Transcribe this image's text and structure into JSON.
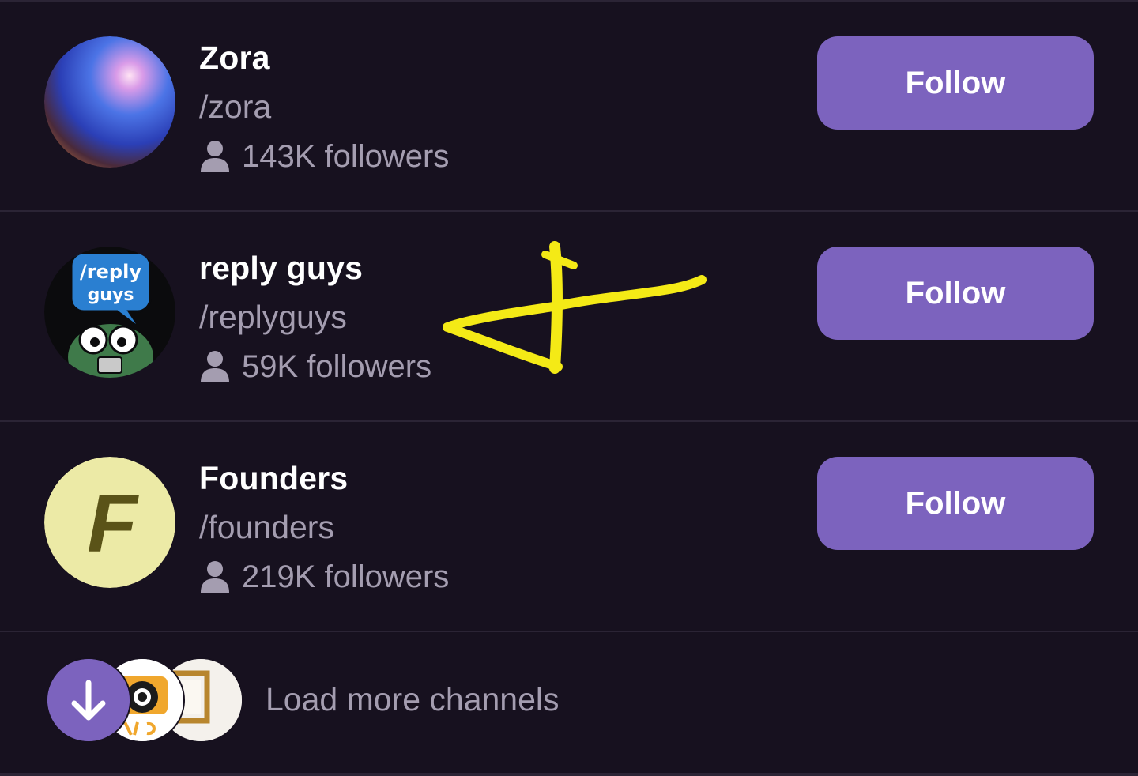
{
  "channels": [
    {
      "name": "Zora",
      "handle": "/zora",
      "followers": "143K followers",
      "follow_label": "Follow",
      "avatar_icon": "gradient-orb-avatar"
    },
    {
      "name": "reply guys",
      "handle": "/replyguys",
      "followers": "59K followers",
      "follow_label": "Follow",
      "avatar_icon": "reply-guys-avatar",
      "avatar_text": "/reply guys"
    },
    {
      "name": "Founders",
      "handle": "/founders",
      "followers": "219K followers",
      "follow_label": "Follow",
      "avatar_icon": "founders-avatar",
      "avatar_text": "F"
    }
  ],
  "load_more": {
    "label": "Load more channels",
    "icon": "arrow-down-icon"
  },
  "colors": {
    "background": "#17111f",
    "divider": "#2b2435",
    "follow_button": "#7c63be",
    "secondary_text": "#a49db0",
    "annotation": "#f4ea16"
  }
}
